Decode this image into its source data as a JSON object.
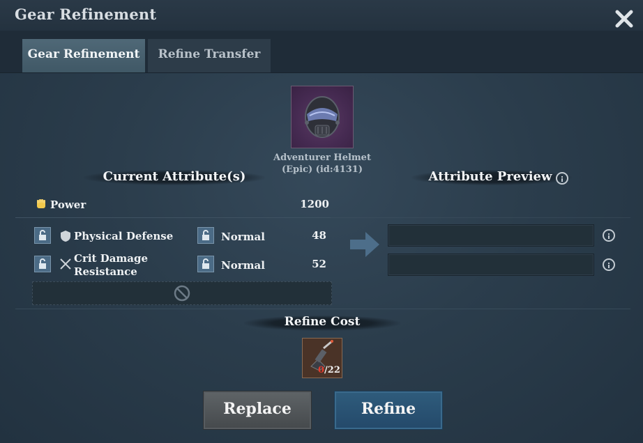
{
  "window": {
    "title": "Gear Refinement"
  },
  "tabs": [
    {
      "label": "Gear Refinement",
      "active": true
    },
    {
      "label": "Refine Transfer",
      "active": false
    }
  ],
  "item": {
    "name_line1": "Adventurer Helmet",
    "name_line2": "(Epic) (id:4131)",
    "rarity_color": "#4b2d55"
  },
  "current": {
    "header": "Current Attribute(s)",
    "power_label": "Power",
    "power_value": "1200",
    "rows": [
      {
        "name": "Physical Defense",
        "name_line2": "",
        "quality": "Normal",
        "value": "48",
        "icon": "shield-icon"
      },
      {
        "name": "Crit Damage",
        "name_line2": "Resistance",
        "quality": "Normal",
        "value": "52",
        "icon": "crossed-swords-icon"
      }
    ]
  },
  "preview": {
    "header": "Attribute Preview"
  },
  "cost": {
    "header": "Refine Cost",
    "owned": "0",
    "required": "/22",
    "owned_color": "#e23b2e"
  },
  "buttons": {
    "replace": "Replace",
    "refine": "Refine"
  },
  "colors": {
    "accent_blue": "#24496a",
    "gray_button": "#4a4e51"
  }
}
